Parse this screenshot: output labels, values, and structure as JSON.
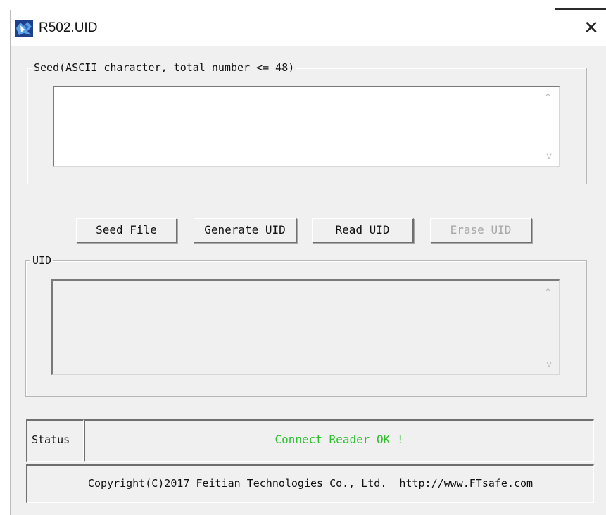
{
  "window": {
    "title": "R502.UID",
    "close_glyph": "✕",
    "icon": "app-puzzle-icon"
  },
  "seed_group": {
    "label": "Seed(ASCII character, total number <= 48)",
    "value": ""
  },
  "buttons": {
    "seed_file": "Seed File",
    "generate_uid": "Generate UID",
    "read_uid": "Read UID",
    "erase_uid": "Erase UID"
  },
  "uid_group": {
    "label": "UID",
    "value": ""
  },
  "scroll": {
    "up": "^",
    "down": "v"
  },
  "status": {
    "label": "Status",
    "text": "Connect Reader OK !",
    "text_color": "#2fbf2f"
  },
  "footer": {
    "copyright": "Copyright(C)2017 Feitian Technologies Co., Ltd.  http://www.FTsafe.com"
  }
}
